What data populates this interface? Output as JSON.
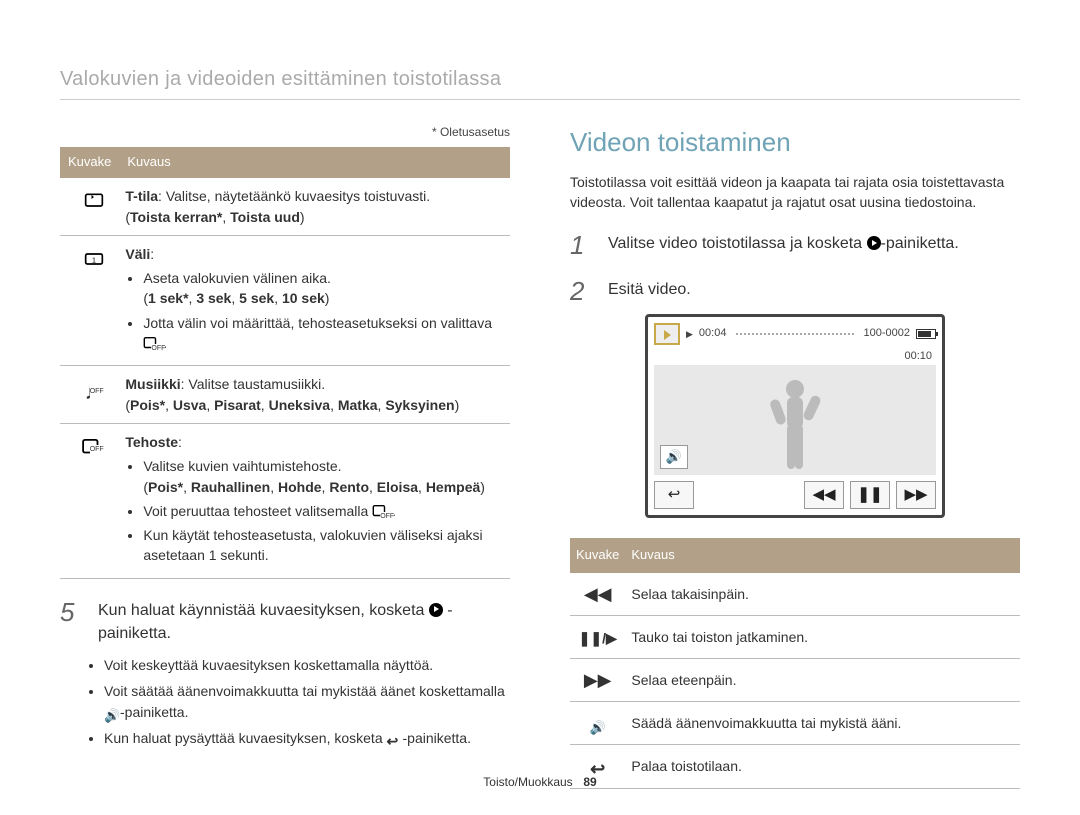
{
  "page": {
    "title": "Valokuvien ja videoiden esittäminen toistotilassa",
    "default_note": "* Oletusasetus",
    "footer_section": "Toisto/Muokkaus",
    "footer_page": "89"
  },
  "left": {
    "table_head": {
      "col1": "Kuvake",
      "col2": "Kuvaus"
    },
    "rows": {
      "tmode": {
        "icon_name": "repeat-icon",
        "lead_bold": "T-tila",
        "lead_rest": ": Valitse, näytetäänkö kuvaesitys toistuvasti.",
        "opts_open": "(",
        "opt1": "Toista kerran*",
        "sep": ", ",
        "opt2": "Toista uud",
        "opts_close": ")"
      },
      "interval": {
        "icon_name": "interval-icon",
        "lead_bold": "Väli",
        "lead_rest": ":",
        "b1": "Aseta valokuvien välinen aika.",
        "opts_open": "(",
        "o1": "1 sek*",
        "o2": "3 sek",
        "o3": "5 sek",
        "o4": "10 sek",
        "opts_close": ")",
        "b2a": "Jotta välin voi määrittää, tehosteasetukseksi on valittava ",
        "b2b": "."
      },
      "music": {
        "icon_name": "music-off-icon",
        "lead_bold": "Musiikki",
        "lead_rest": ": Valitse taustamusiikki.",
        "opts_open": "(",
        "o1": "Pois*",
        "o2": "Usva",
        "o3": "Pisarat",
        "o4": "Uneksiva",
        "o5": "Matka",
        "o6": "Syksyinen",
        "opts_close": ")"
      },
      "effect": {
        "icon_name": "effect-off-icon",
        "lead_bold": "Tehoste",
        "lead_rest": ":",
        "b1": "Valitse kuvien vaihtumistehoste.",
        "opts_open": "(",
        "o1": "Pois*",
        "o2": "Rauhallinen",
        "o3": "Hohde",
        "o4": "Rento",
        "o5": "Eloisa",
        "o6": "Hempeä",
        "opts_close": ")",
        "b2a": "Voit peruuttaa tehosteet valitsemalla ",
        "b2b": ".",
        "b3": "Kun käytät tehosteasetusta, valokuvien väliseksi ajaksi asetetaan 1 sekunti."
      }
    },
    "step5": {
      "num": "5",
      "text_a": "Kun haluat käynnistää kuvaesityksen, kosketa ",
      "text_b": " -painiketta."
    },
    "step5_sub": {
      "b1": "Voit keskeyttää kuvaesityksen koskettamalla näyttöä.",
      "b2a": "Voit säätää äänenvoimakkuutta tai mykistää äänet koskettamalla ",
      "b2b": "-painiketta.",
      "b3a": "Kun haluat pysäyttää kuvaesityksen, kosketa ",
      "b3b": "-painiketta."
    }
  },
  "right": {
    "title": "Videon toistaminen",
    "intro": "Toistotilassa voit esittää videon ja kaapata tai rajata osia toistettavasta videosta. Voit tallentaa kaapatut ja rajatut osat uusina tiedostoina.",
    "step1": {
      "num": "1",
      "text_a": "Valitse video toistotilassa ja kosketa ",
      "text_b": "-painiketta."
    },
    "step2": {
      "num": "2",
      "text": "Esitä video."
    },
    "video": {
      "elapsed": "00:04",
      "file": "100-0002",
      "total": "00:10"
    },
    "table_head": {
      "col1": "Kuvake",
      "col2": "Kuvaus"
    },
    "controls": {
      "rewind": "Selaa takaisinpäin.",
      "pauseplay": "Tauko tai toiston jatkaminen.",
      "forward": "Selaa eteenpäin.",
      "volume": "Säädä äänenvoimakkuutta tai mykistä ääni.",
      "return": "Palaa toistotilaan."
    }
  }
}
